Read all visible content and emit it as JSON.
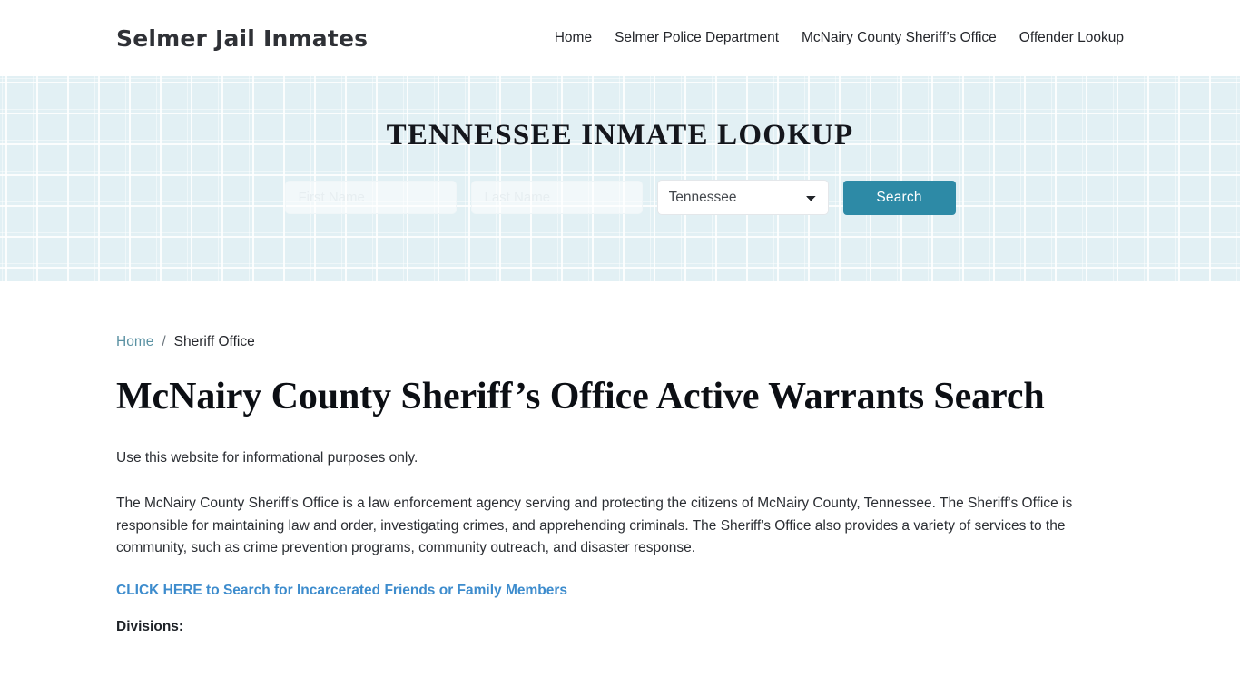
{
  "header": {
    "brand": "Selmer Jail Inmates",
    "nav": [
      {
        "label": "Home"
      },
      {
        "label": "Selmer Police Department"
      },
      {
        "label": "McNairy County Sheriff’s Office"
      },
      {
        "label": "Offender Lookup"
      }
    ]
  },
  "hero": {
    "title": "TENNESSEE INMATE LOOKUP",
    "form": {
      "first_name_placeholder": "First Name",
      "first_name_value": "",
      "last_name_placeholder": "Last Name",
      "last_name_value": "",
      "state_selected": "Tennessee",
      "state_options": [
        "Tennessee"
      ],
      "search_label": "Search"
    },
    "colors": {
      "background": "#e2f0f4",
      "grid_line": "#ffffff",
      "button": "#2d8aa6"
    }
  },
  "breadcrumb": {
    "home": "Home",
    "separator": "/",
    "current": "Sheriff Office"
  },
  "main": {
    "title": "McNairy County Sheriff’s Office Active Warrants Search",
    "disclaimer": "Use this website for informational purposes only.",
    "description": "The McNairy County Sheriff's Office is a law enforcement agency serving and protecting the citizens of McNairy County, Tennessee. The Sheriff's Office is responsible for maintaining law and order, investigating crimes, and apprehending criminals. The Sheriff's Office also provides a variety of services to the community, such as crime prevention programs, community outreach, and disaster response.",
    "cta_link": "CLICK HERE to Search for Incarcerated Friends or Family Members",
    "divisions_label": "Divisions:",
    "link_color": "#3d8ccd"
  }
}
